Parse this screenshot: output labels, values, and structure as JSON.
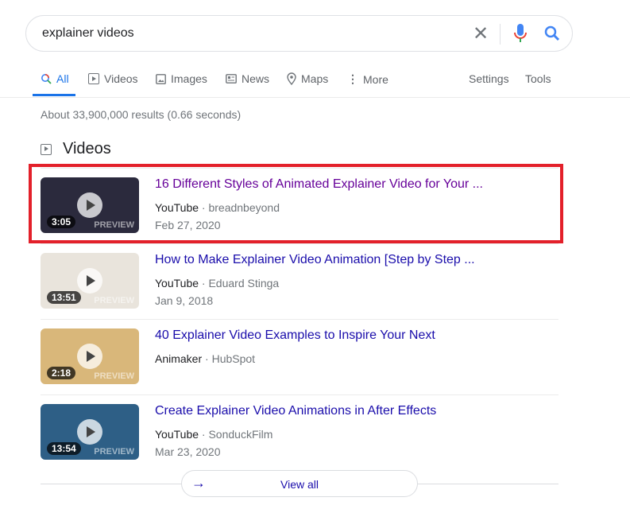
{
  "search": {
    "query": "explainer videos"
  },
  "tabs": [
    {
      "label": "All",
      "icon": "search-icon"
    },
    {
      "label": "Videos",
      "icon": "video-icon"
    },
    {
      "label": "Images",
      "icon": "image-icon"
    },
    {
      "label": "News",
      "icon": "news-icon"
    },
    {
      "label": "Maps",
      "icon": "map-pin-icon"
    },
    {
      "label": "More",
      "icon": "more-vert-icon"
    }
  ],
  "tools": {
    "settings": "Settings",
    "tools": "Tools"
  },
  "stats": "About 33,900,000 results (0.66 seconds)",
  "videos_heading": "Videos",
  "videos": [
    {
      "title": "16 Different Styles of Animated Explainer Video for Your ...",
      "source": "YouTube",
      "channel": "breadnbeyond",
      "date": "Feb 27, 2020",
      "duration": "3:05",
      "preview": "PREVIEW",
      "visited": true,
      "highlighted": true,
      "thumb_color": "#2b2a3d"
    },
    {
      "title": "How to Make Explainer Video Animation [Step by Step ...",
      "source": "YouTube",
      "channel": "Eduard Stinga",
      "date": "Jan 9, 2018",
      "duration": "13:51",
      "preview": "PREVIEW",
      "visited": false,
      "thumb_color": "#e9e4dc"
    },
    {
      "title": "40 Explainer Video Examples to Inspire Your Next",
      "source": "Animaker",
      "channel": "HubSpot",
      "date": "",
      "duration": "2:18",
      "preview": "PREVIEW",
      "visited": false,
      "thumb_color": "#d9b77a"
    },
    {
      "title": "Create Explainer Video Animations in After Effects",
      "source": "YouTube",
      "channel": "SonduckFilm",
      "date": "Mar 23, 2020",
      "duration": "13:54",
      "preview": "PREVIEW",
      "visited": false,
      "thumb_color": "#2e5f86"
    }
  ],
  "view_all": "View all",
  "colors": {
    "link": "#1a0dab",
    "visited": "#660099",
    "accent": "#1a73e8",
    "highlight_box": "#e3202a"
  }
}
